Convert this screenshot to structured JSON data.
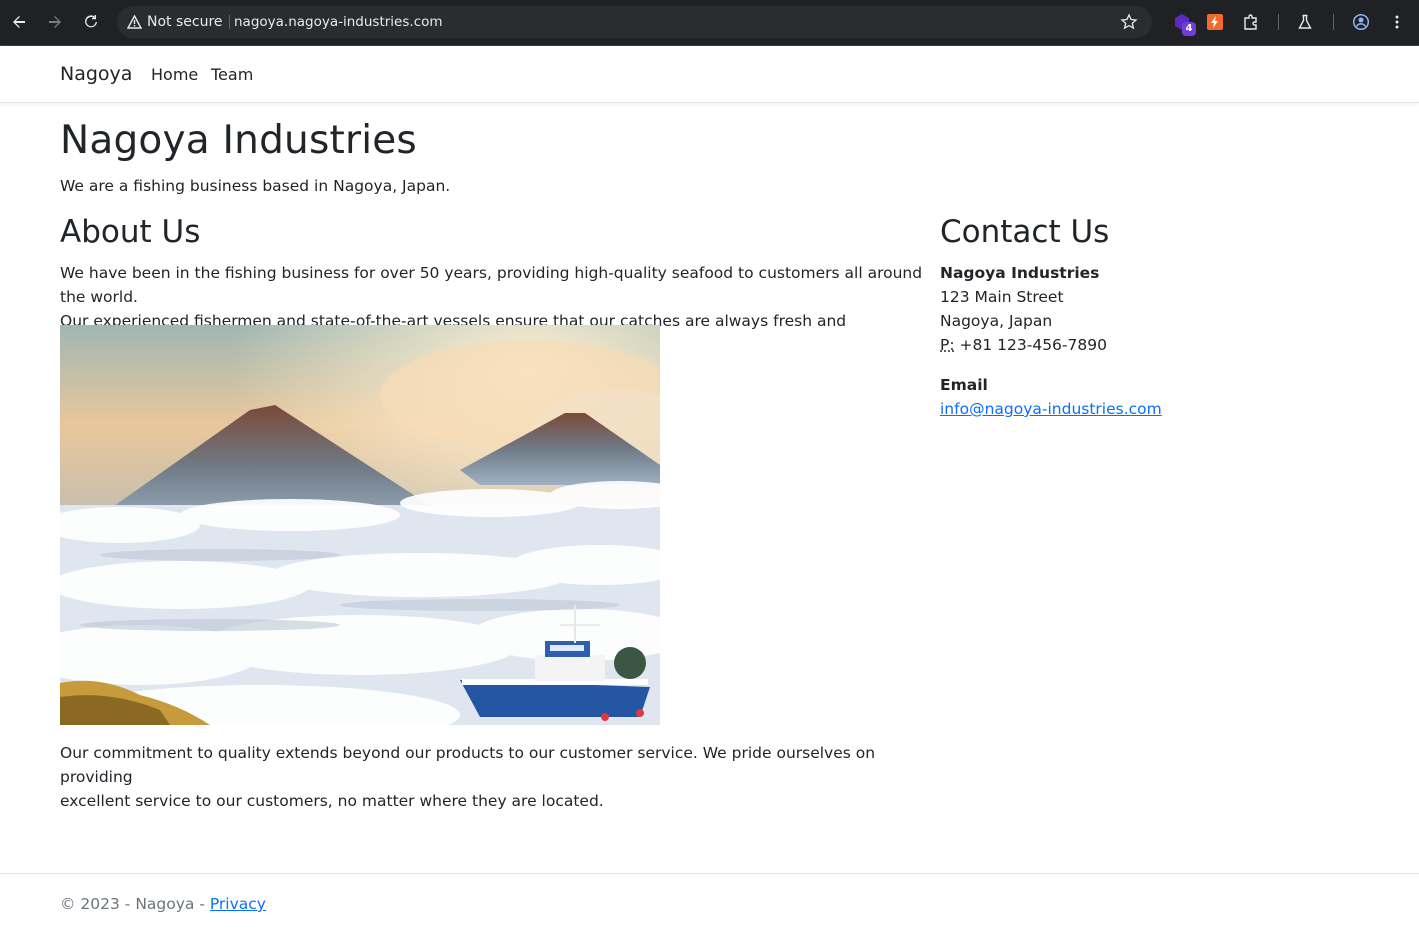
{
  "browser": {
    "security_label": "Not secure",
    "url": "nagoya.nagoya-industries.com",
    "extension_badge": "4"
  },
  "navbar": {
    "brand": "Nagoya",
    "links": [
      "Home",
      "Team"
    ]
  },
  "hero": {
    "title": "Nagoya Industries",
    "tagline": "We are a fishing business based in Nagoya, Japan."
  },
  "about": {
    "heading": "About Us",
    "paragraph1_line1": "We have been in the fishing business for over 50 years, providing high-quality seafood to customers all around the world.",
    "paragraph1_line2": "Our experienced fishermen and state-of-the-art vessels ensure that our catches are always fresh and sustainable.",
    "paragraph2_line1": "Our commitment to quality extends beyond our products to our customer service. We pride ourselves on providing",
    "paragraph2_line2": "excellent service to our customers, no matter where they are located."
  },
  "contact": {
    "heading": "Contact Us",
    "company": "Nagoya Industries",
    "street": "123 Main Street",
    "city": "Nagoya, Japan",
    "phone_label": "P:",
    "phone": "+81 123-456-7890",
    "email_label": "Email",
    "email": "info@nagoya-industries.com"
  },
  "footer": {
    "text": "© 2023 - Nagoya - ",
    "privacy_link": "Privacy"
  }
}
